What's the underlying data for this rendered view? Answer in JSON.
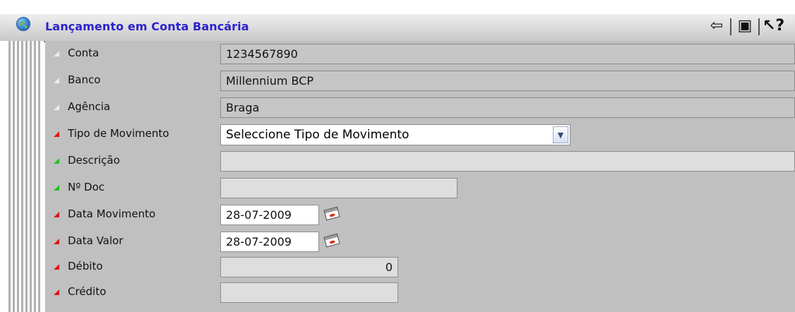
{
  "window": {
    "title": "Lançamento em Conta Bancária",
    "icons": [
      "back-arrow-icon",
      "copy-icon",
      "help-pointer-icon"
    ]
  },
  "form": {
    "conta": {
      "label": "Conta",
      "value": "1234567890"
    },
    "banco": {
      "label": "Banco",
      "value": "Millennium BCP"
    },
    "agencia": {
      "label": "Agência",
      "value": "Braga"
    },
    "tipo_movimento": {
      "label": "Tipo de Movimento",
      "selected": "Seleccione Tipo de Movimento"
    },
    "descricao": {
      "label": "Descrição",
      "value": ""
    },
    "n_doc": {
      "label": "Nº Doc",
      "value": ""
    },
    "data_movimento": {
      "label": "Data Movimento",
      "value": "28-07-2009"
    },
    "data_valor": {
      "label": "Data Valor",
      "value": "28-07-2009"
    },
    "debito": {
      "label": "Débito",
      "value": "0"
    },
    "credito": {
      "label": "Crédito",
      "value": ""
    }
  },
  "colors": {
    "title": "#2a22cc",
    "required_marker": "#e01414",
    "optional_marker": "#21c221",
    "panel_bg": "#c0c0c0"
  }
}
